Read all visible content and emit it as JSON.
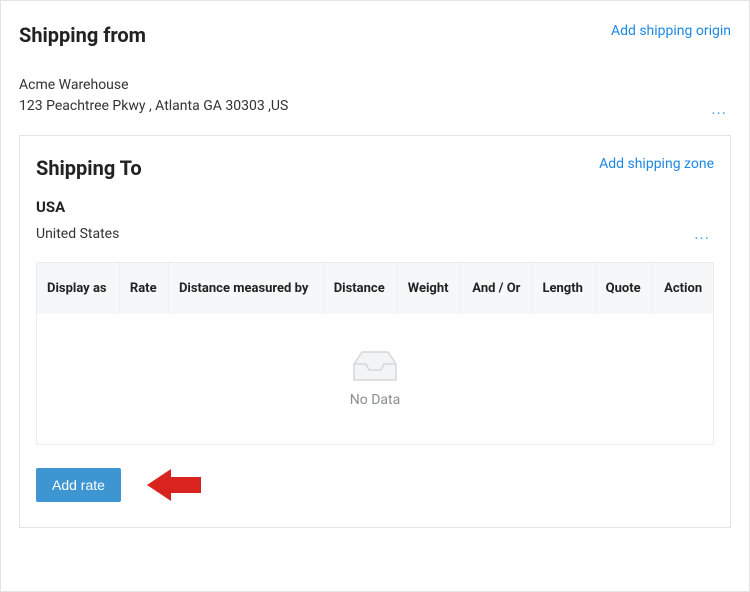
{
  "shippingFrom": {
    "title": "Shipping from",
    "addOriginLabel": "Add shipping origin",
    "origin": {
      "name": "Acme Warehouse",
      "address": "123 Peachtree Pkwy , Atlanta GA 30303 ,US"
    }
  },
  "shippingTo": {
    "title": "Shipping To",
    "addZoneLabel": "Add shipping zone",
    "zone": {
      "name": "USA",
      "country": "United States"
    },
    "table": {
      "columns": {
        "displayAs": "Display as",
        "rate": "Rate",
        "distanceMeasuredBy": "Distance measured by",
        "distance": "Distance",
        "weight": "Weight",
        "andOr": "And / Or",
        "length": "Length",
        "quote": "Quote",
        "action": "Action"
      },
      "emptyLabel": "No Data"
    },
    "addRateLabel": "Add rate"
  },
  "glyphs": {
    "more": "..."
  }
}
